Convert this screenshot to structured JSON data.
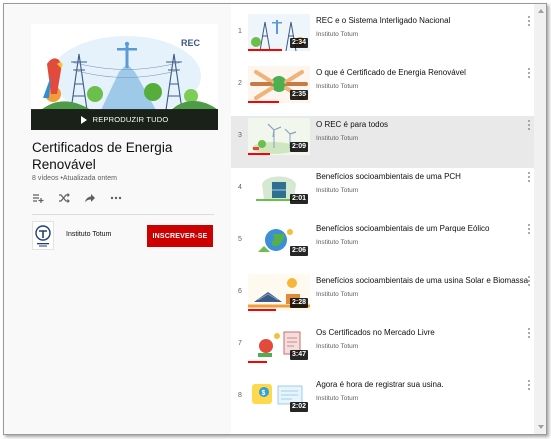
{
  "playlist": {
    "title": "Certificados de Energia Renovável",
    "video_count": "8 vídeos",
    "updated": "Atualizada ontem",
    "play_all_label": "REPRODUZIR TUDO",
    "hero_text": "REC"
  },
  "channel": {
    "name": "Instituto Totum",
    "subscribe_label": "INSCREVER-SE"
  },
  "actions": [
    "add-to-queue-icon",
    "shuffle-icon",
    "share-icon",
    "more-icon"
  ],
  "colors": {
    "subscribe": "#cc0000",
    "progress": "#ff0000",
    "active_row": "#e9e9e9",
    "panel_bg": "#f9f9f9"
  },
  "videos": [
    {
      "index": "1",
      "title": "REC e o Sistema Interligado Nacional",
      "channel": "Instituto Totum",
      "duration": "2:34",
      "watched": 0.55,
      "theme": "power"
    },
    {
      "index": "2",
      "title": "O que é Certificado de Energia Renovável",
      "channel": "Instituto Totum",
      "duration": "2:35",
      "watched": 0.5,
      "theme": "hands"
    },
    {
      "index": "3",
      "title": "O REC é para todos",
      "channel": "Instituto Totum",
      "duration": "2:09",
      "watched": 0.35,
      "theme": "wind"
    },
    {
      "index": "4",
      "title": "Benefícios socioambientais de uma PCH",
      "channel": "Instituto Totum",
      "duration": "2:01",
      "watched": 0,
      "theme": "hydro"
    },
    {
      "index": "5",
      "title": "Benefícios socioambientais de um Parque Eólico",
      "channel": "Instituto Totum",
      "duration": "2:06",
      "watched": 0,
      "theme": "globe"
    },
    {
      "index": "6",
      "title": "Benefícios socioambientais de uma usina Solar e Biomassa",
      "channel": "Instituto Totum",
      "duration": "2:28",
      "watched": 0.45,
      "theme": "solar"
    },
    {
      "index": "7",
      "title": "Os Certificados no Mercado Livre",
      "channel": "Instituto Totum",
      "duration": "3:47",
      "watched": 0.3,
      "theme": "market"
    },
    {
      "index": "8",
      "title": "Agora é hora de registrar sua usina.",
      "channel": "Instituto Totum",
      "duration": "2:02",
      "watched": 0,
      "theme": "register"
    }
  ]
}
